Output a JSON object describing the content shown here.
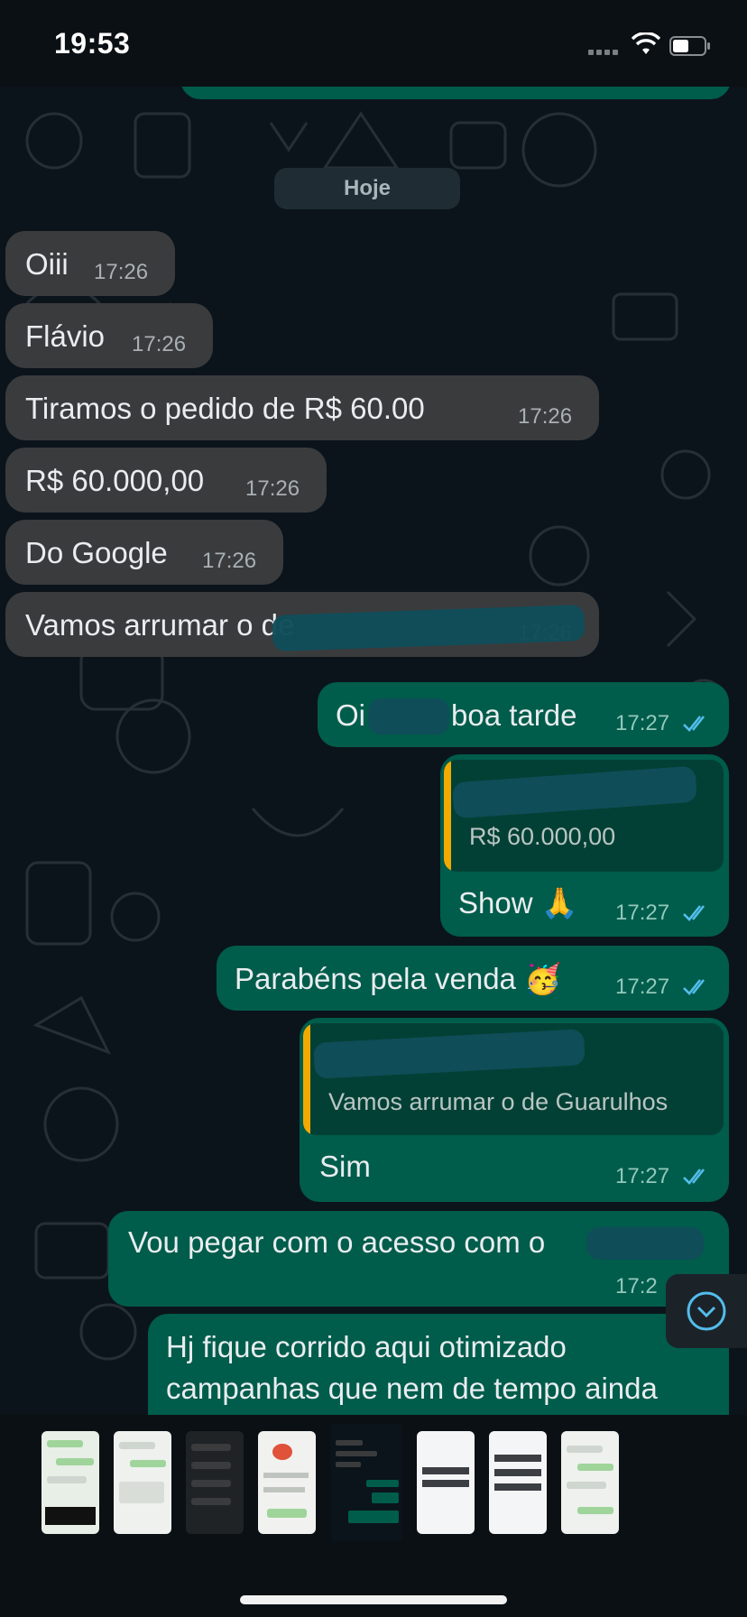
{
  "status_bar": {
    "time": "19:53"
  },
  "chat": {
    "date_label": "Hoje",
    "messages": [
      {
        "text": "Oiii",
        "time": "17:26"
      },
      {
        "text": "Flávio",
        "time": "17:26"
      },
      {
        "text": "Tiramos o pedido de R$ 60.00",
        "time": "17:26"
      },
      {
        "text": "R$ 60.000,00",
        "time": "17:26"
      },
      {
        "text": "Do Google",
        "time": "17:26"
      },
      {
        "text": "Vamos arrumar o de",
        "time": "17:26"
      },
      {
        "text": "Oi",
        "text2": "boa tarde",
        "time": "17:27"
      },
      {
        "quote": "R$ 60.000,00",
        "text": "Show 🙏",
        "time": "17:27"
      },
      {
        "text": "Parabéns pela venda 🥳",
        "time": "17:27"
      },
      {
        "quote": "Vamos arrumar o de Guarulhos",
        "text": "Sim",
        "time": "17:27"
      },
      {
        "text": "Vou pegar com o acesso com o",
        "time": "17:2"
      },
      {
        "line1": "Hj fique corrido aqui otimizado",
        "line2": "campanhas que nem de tempo ainda"
      }
    ]
  },
  "icons": {
    "read_receipt": "double-check-icon",
    "scroll_down": "chevron-down-circle-icon",
    "wifi": "wifi-icon",
    "battery": "battery-icon",
    "signal": "signal-icon"
  },
  "colors": {
    "incoming_bubble": "#3a3b3d",
    "outgoing_bubble": "#005c4b",
    "quote_bar": "#f2a900",
    "read_ticks": "#53bdeb",
    "background": "#0b141a"
  },
  "thumbnails": {
    "count": 8,
    "selected_index": 4
  }
}
